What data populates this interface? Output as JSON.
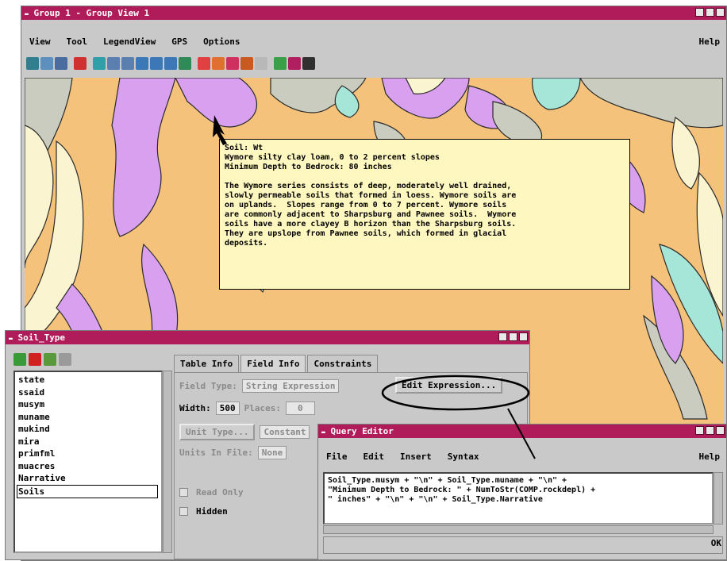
{
  "main_window": {
    "title": "Group 1 - Group View 1",
    "menu": [
      "View",
      "Tool",
      "LegendView",
      "GPS",
      "Options"
    ],
    "help": "Help"
  },
  "toolbar_icons": [
    "zoom-world-icon",
    "zoom-fit-icon",
    "zoom-extent-icon",
    "add-layer-icon",
    "select-icon",
    "rotate-icon",
    "rotate-back-icon",
    "zoom-in-icon",
    "zoom-out-icon",
    "zoom-window-icon",
    "pan-icon",
    "find-icon",
    "measure-icon",
    "pointer-icon",
    "edit-icon",
    "gps-icon",
    "legend-icon",
    "layer-icon",
    "signal-icon"
  ],
  "datatip": {
    "text": "Soil: Wt\nWymore silty clay loam, 0 to 2 percent slopes\nMinimum Depth to Bedrock: 80 inches\n\nThe Wymore series consists of deep, moderately well drained,\nslowly permeable soils that formed in loess. Wymore soils are\non uplands.  Slopes range from 0 to 7 percent. Wymore soils\nare commonly adjacent to Sharpsburg and Pawnee soils.  Wymore\nsoils have a more clayey B horizon than the Sharpsburg soils.\nThey are upslope from Pawnee soils, which formed in glacial\ndeposits."
  },
  "soil_window": {
    "title": "Soil_Type",
    "fields": [
      "state",
      "ssaid",
      "musym",
      "muname",
      "mukind",
      "mira",
      "primfml",
      "muacres",
      "Narrative",
      "Soils"
    ],
    "selected_field": "Soils",
    "tabs": [
      "Table Info",
      "Field Info",
      "Constraints"
    ],
    "active_tab": "Field Info",
    "field_type_label": "Field Type:",
    "field_type_value": "String Expression",
    "edit_expression_button": "Edit Expression...",
    "width_label": "Width:",
    "width_value": "500",
    "places_label": "Places:",
    "places_value": "0",
    "unit_type_button": "Unit Type...",
    "unit_type_value": "Constant",
    "units_in_file_label": "Units In File:",
    "units_in_file_value": "None",
    "read_only_label": "Read Only",
    "hidden_label": "Hidden"
  },
  "query_editor": {
    "title": "Query Editor",
    "menu": [
      "File",
      "Edit",
      "Insert",
      "Syntax"
    ],
    "help": "Help",
    "expression": "Soil_Type.musym + \"\\n\" + Soil_Type.muname + \"\\n\" +\n\"Minimum Depth to Bedrock: \" + NumToStr(COMP.rockdepl) +\n\" inches\" + \"\\n\" + \"\\n\" + Soil_Type.Narrative",
    "ok_label": "OK"
  },
  "colors": {
    "title_bar": "#b01c5a",
    "map_tan": "#f4c27a",
    "map_purple": "#d9a0ef",
    "map_teal": "#a6e6d8",
    "map_gray": "#c9ccbf",
    "map_cream": "#fbf4d0",
    "tooltip_bg": "#fff7c0"
  }
}
